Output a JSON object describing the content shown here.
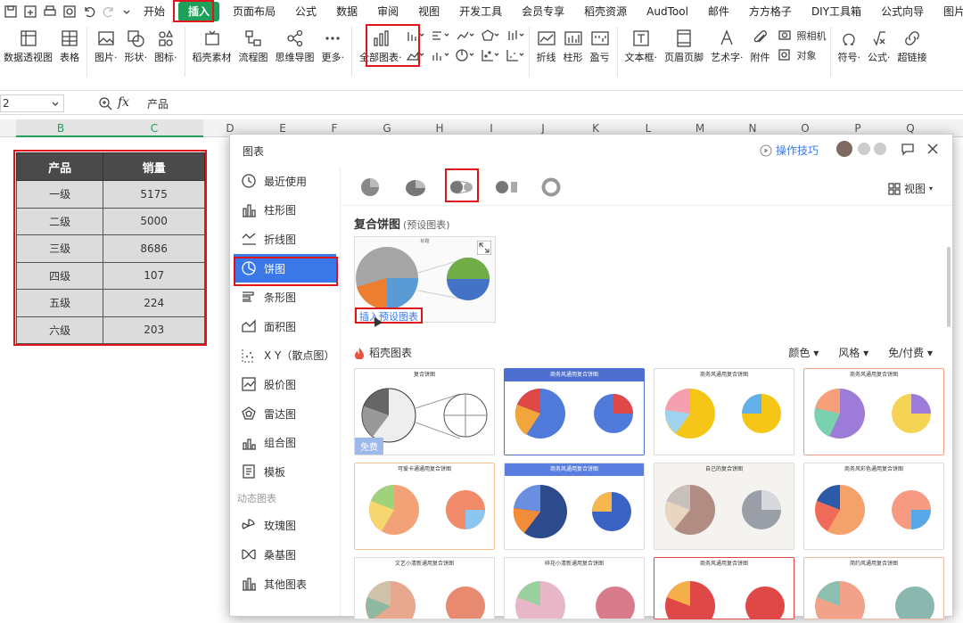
{
  "ribbon": {
    "tabs": [
      "开始",
      "插入",
      "页面布局",
      "公式",
      "数据",
      "审阅",
      "视图",
      "开发工具",
      "会员专享",
      "稻壳资源",
      "AudTool",
      "邮件",
      "方方格子",
      "DIY工具箱",
      "公式向导",
      "图片工具"
    ],
    "tools": [
      "数据透视图",
      "表格",
      "图片·",
      "形状·",
      "图标·",
      "稻壳素材",
      "流程图",
      "思维导图",
      "更多·",
      "全部图表·",
      "折线",
      "柱形",
      "盈亏",
      "文本框·",
      "页眉页脚",
      "艺术字·",
      "附件",
      "对象",
      "符号·",
      "公式·",
      "超链接"
    ],
    "camera": "照相机"
  },
  "formula": {
    "namebox": "2",
    "fx": "fx",
    "value": "产品"
  },
  "columns": [
    "B",
    "C",
    "D",
    "E",
    "F",
    "G",
    "H",
    "I",
    "J",
    "K",
    "L",
    "M",
    "N",
    "O",
    "P",
    "Q"
  ],
  "table": {
    "headers": [
      "产品",
      "销量"
    ],
    "rows": [
      [
        "一级",
        "5175"
      ],
      [
        "二级",
        "5000"
      ],
      [
        "三级",
        "8686"
      ],
      [
        "四级",
        "107"
      ],
      [
        "五级",
        "224"
      ],
      [
        "六级",
        "203"
      ]
    ]
  },
  "dialog": {
    "title": "图表",
    "tips": "操作技巧",
    "view": "视图",
    "nav": [
      "最近使用",
      "柱形图",
      "折线图",
      "饼图",
      "条形图",
      "面积图",
      "X Y（散点图）",
      "股价图",
      "雷达图",
      "组合图",
      "模板"
    ],
    "dyn_section": "动态图表",
    "dyn": [
      "玫瑰图",
      "桑基图",
      "其他图表"
    ],
    "preset_title": "复合饼图",
    "preset_sub": "(预设图表)",
    "insert_preset": "插入预设图表",
    "preview_title": "标题",
    "docer": "稻壳图表",
    "filters": [
      "颜色",
      "风格",
      "免/付费"
    ],
    "free": "免费",
    "cards": [
      "复合饼图",
      "商务风通用复合饼图",
      "商务风通用复合饼图",
      "商务风通用复合饼图",
      "可爱卡通通用复合饼图",
      "商务风通用复合饼图",
      "自己的复合饼图",
      "商务风彩色通用复合饼图",
      "文艺小清新通用复合饼图",
      "碎花小清新通用复合饼图",
      "商务风通用复合饼图",
      "简约风通用复合饼图"
    ]
  },
  "colors": {
    "accent": "#1fa05a",
    "select": "#3b78e7",
    "highlight": "#e0141b"
  }
}
